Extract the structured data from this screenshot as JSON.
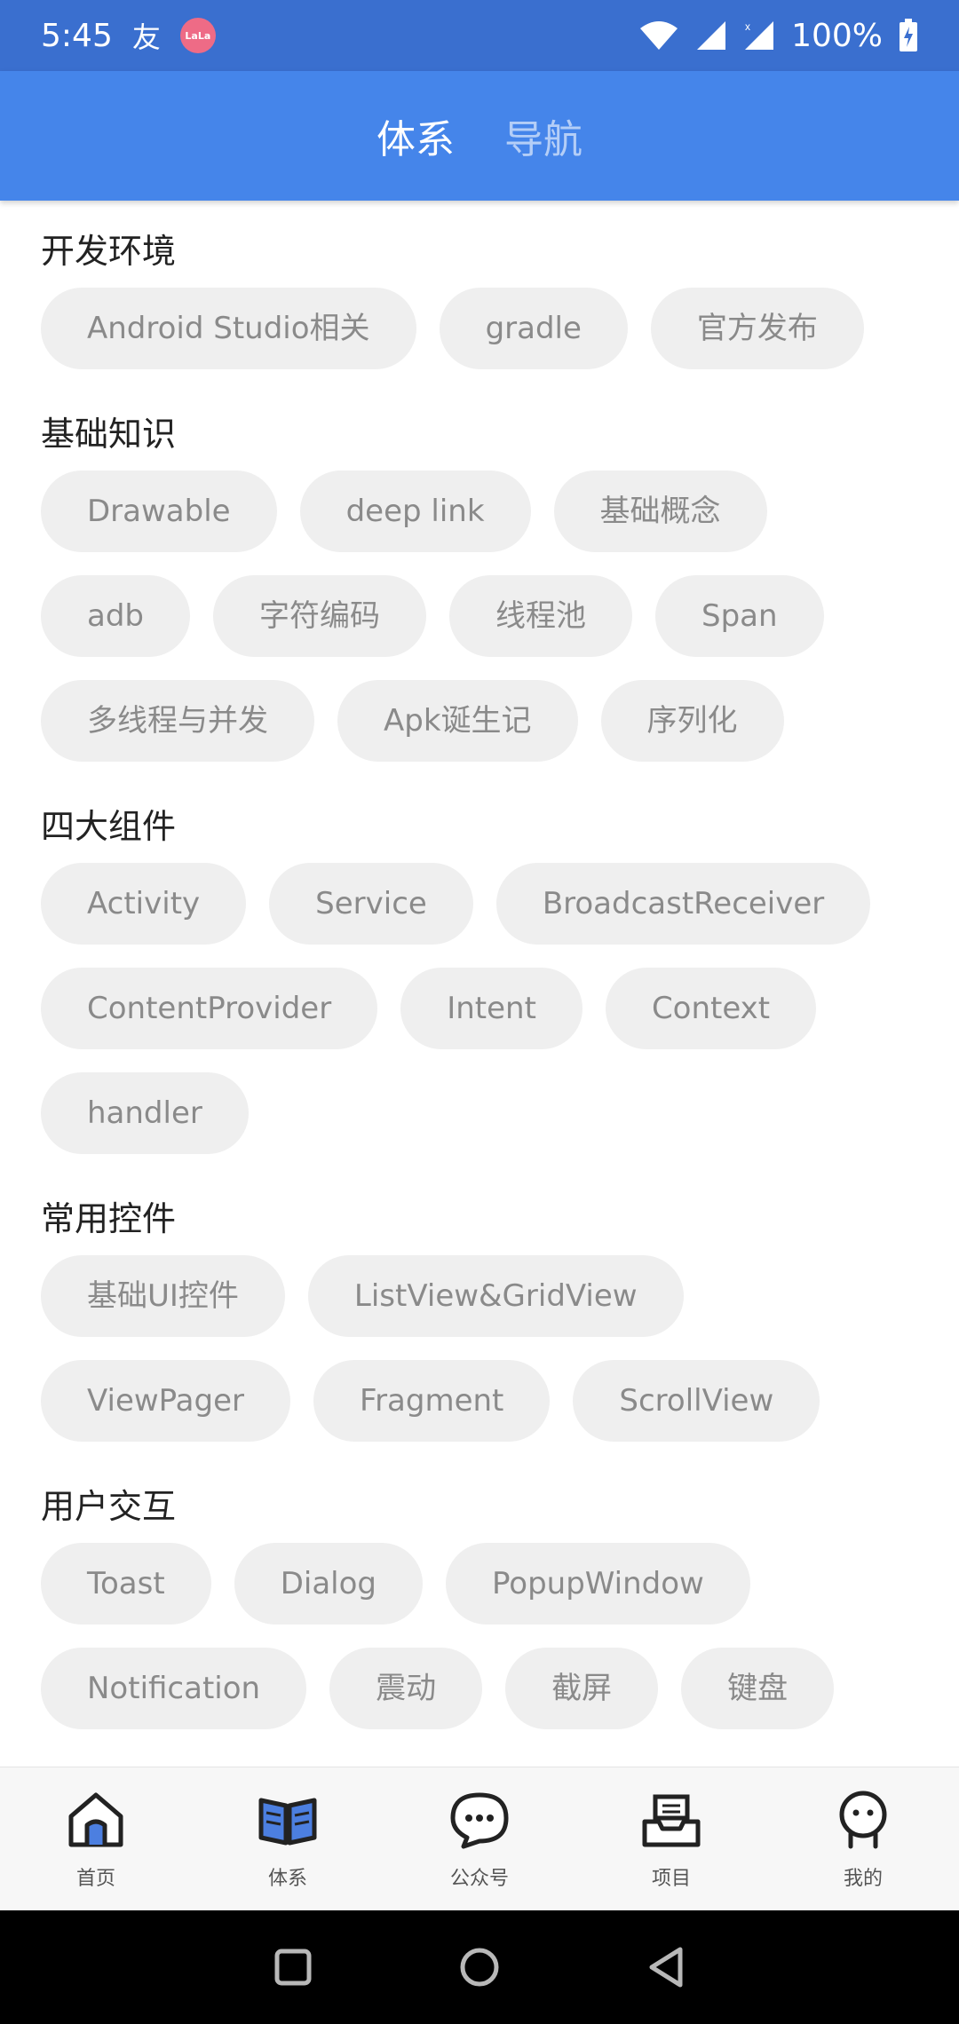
{
  "status_bar": {
    "time": "5:45",
    "glyph": "友",
    "badge": "LaLa",
    "battery": "100%"
  },
  "app_bar": {
    "tabs": [
      {
        "label": "体系",
        "active": true
      },
      {
        "label": "导航",
        "active": false
      }
    ]
  },
  "sections": [
    {
      "title": "开发环境",
      "chips": [
        "Android Studio相关",
        "gradle",
        "官方发布"
      ]
    },
    {
      "title": "基础知识",
      "chips": [
        "Drawable",
        "deep link",
        "基础概念",
        "adb",
        "字符编码",
        "线程池",
        "Span",
        "多线程与并发",
        "Apk诞生记",
        "序列化"
      ]
    },
    {
      "title": "四大组件",
      "chips": [
        "Activity",
        "Service",
        "BroadcastReceiver",
        "ContentProvider",
        "Intent",
        "Context",
        "handler"
      ]
    },
    {
      "title": "常用控件",
      "chips": [
        "基础UI控件",
        "ListView&GridView",
        "ViewPager",
        "Fragment",
        "ScrollView"
      ]
    },
    {
      "title": "用户交互",
      "chips": [
        "Toast",
        "Dialog",
        "PopupWindow",
        "Notification",
        "震动",
        "截屏",
        "键盘"
      ]
    }
  ],
  "bottom_nav": {
    "items": [
      {
        "label": "首页",
        "icon": "home-icon"
      },
      {
        "label": "体系",
        "icon": "book-icon"
      },
      {
        "label": "公众号",
        "icon": "chat-bubble-icon"
      },
      {
        "label": "项目",
        "icon": "inbox-tray-icon"
      },
      {
        "label": "我的",
        "icon": "person-icon"
      }
    ]
  },
  "colors": {
    "status_bar": "#3a6fcf",
    "app_bar": "#4585ea",
    "chip_bg": "#efefef",
    "chip_text": "#8a8a8a"
  }
}
